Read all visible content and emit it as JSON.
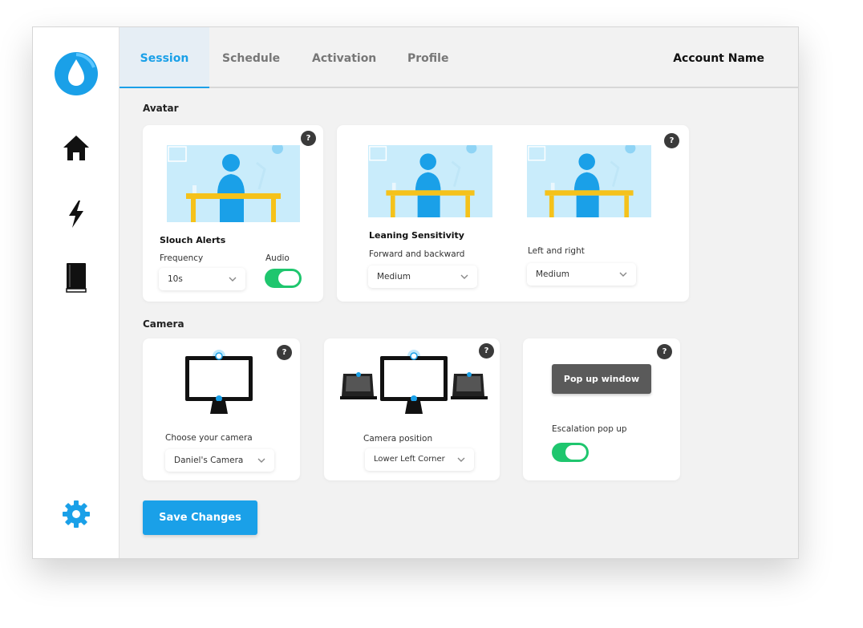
{
  "tabs": {
    "session": "Session",
    "schedule": "Schedule",
    "activation": "Activation",
    "profile": "Profile"
  },
  "account_name": "Account Name",
  "sidebar": {
    "icons": [
      "logo-icon",
      "home-icon",
      "lightning-icon",
      "book-icon",
      "gear-icon"
    ]
  },
  "avatar": {
    "section_title": "Avatar",
    "slouch": {
      "title": "Slouch Alerts",
      "frequency_label": "Frequency",
      "frequency_value": "10s",
      "audio_label": "Audio",
      "audio_on": true
    },
    "leaning": {
      "title": "Leaning Sensitivity",
      "fb_label": "Forward and backward",
      "fb_value": "Medium",
      "lr_label": "Left and right",
      "lr_value": "Medium"
    },
    "help": "?"
  },
  "camera": {
    "section_title": "Camera",
    "choose_label": "Choose your camera",
    "choose_value": "Daniel's Camera",
    "position_label": "Camera position",
    "position_value": "Lower Left Corner",
    "popup_button": "Pop up window",
    "escalation_label": "Escalation pop up",
    "escalation_on": true,
    "help": "?"
  },
  "save_button": "Save Changes",
  "colors": {
    "accent": "#1aa0e8",
    "toggle": "#1fc66e",
    "desk": "#f5c21b",
    "person": "#1aa0e8"
  }
}
